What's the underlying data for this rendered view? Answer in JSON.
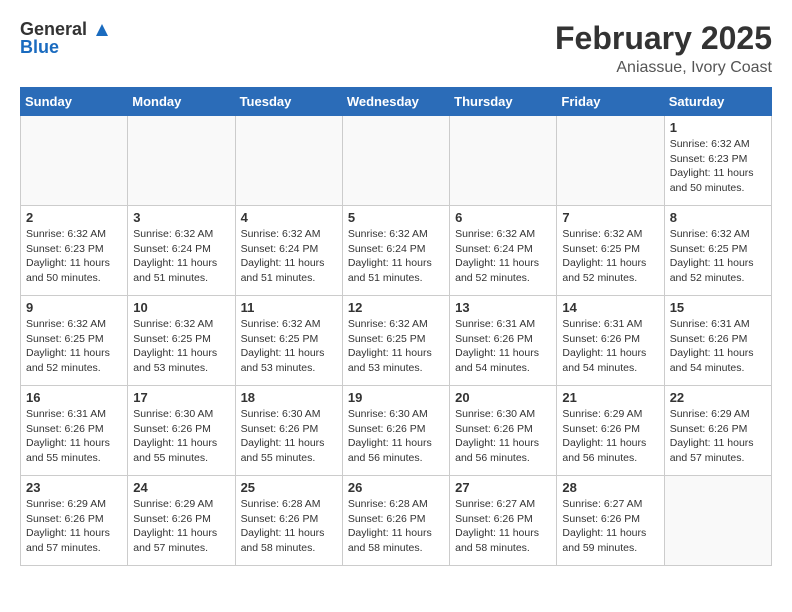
{
  "header": {
    "logo_general": "General",
    "logo_blue": "Blue",
    "month_title": "February 2025",
    "location": "Aniassue, Ivory Coast"
  },
  "weekdays": [
    "Sunday",
    "Monday",
    "Tuesday",
    "Wednesday",
    "Thursday",
    "Friday",
    "Saturday"
  ],
  "weeks": [
    [
      {
        "day": "",
        "info": ""
      },
      {
        "day": "",
        "info": ""
      },
      {
        "day": "",
        "info": ""
      },
      {
        "day": "",
        "info": ""
      },
      {
        "day": "",
        "info": ""
      },
      {
        "day": "",
        "info": ""
      },
      {
        "day": "1",
        "info": "Sunrise: 6:32 AM\nSunset: 6:23 PM\nDaylight: 11 hours\nand 50 minutes."
      }
    ],
    [
      {
        "day": "2",
        "info": "Sunrise: 6:32 AM\nSunset: 6:23 PM\nDaylight: 11 hours\nand 50 minutes."
      },
      {
        "day": "3",
        "info": "Sunrise: 6:32 AM\nSunset: 6:24 PM\nDaylight: 11 hours\nand 51 minutes."
      },
      {
        "day": "4",
        "info": "Sunrise: 6:32 AM\nSunset: 6:24 PM\nDaylight: 11 hours\nand 51 minutes."
      },
      {
        "day": "5",
        "info": "Sunrise: 6:32 AM\nSunset: 6:24 PM\nDaylight: 11 hours\nand 51 minutes."
      },
      {
        "day": "6",
        "info": "Sunrise: 6:32 AM\nSunset: 6:24 PM\nDaylight: 11 hours\nand 52 minutes."
      },
      {
        "day": "7",
        "info": "Sunrise: 6:32 AM\nSunset: 6:25 PM\nDaylight: 11 hours\nand 52 minutes."
      },
      {
        "day": "8",
        "info": "Sunrise: 6:32 AM\nSunset: 6:25 PM\nDaylight: 11 hours\nand 52 minutes."
      }
    ],
    [
      {
        "day": "9",
        "info": "Sunrise: 6:32 AM\nSunset: 6:25 PM\nDaylight: 11 hours\nand 52 minutes."
      },
      {
        "day": "10",
        "info": "Sunrise: 6:32 AM\nSunset: 6:25 PM\nDaylight: 11 hours\nand 53 minutes."
      },
      {
        "day": "11",
        "info": "Sunrise: 6:32 AM\nSunset: 6:25 PM\nDaylight: 11 hours\nand 53 minutes."
      },
      {
        "day": "12",
        "info": "Sunrise: 6:32 AM\nSunset: 6:25 PM\nDaylight: 11 hours\nand 53 minutes."
      },
      {
        "day": "13",
        "info": "Sunrise: 6:31 AM\nSunset: 6:26 PM\nDaylight: 11 hours\nand 54 minutes."
      },
      {
        "day": "14",
        "info": "Sunrise: 6:31 AM\nSunset: 6:26 PM\nDaylight: 11 hours\nand 54 minutes."
      },
      {
        "day": "15",
        "info": "Sunrise: 6:31 AM\nSunset: 6:26 PM\nDaylight: 11 hours\nand 54 minutes."
      }
    ],
    [
      {
        "day": "16",
        "info": "Sunrise: 6:31 AM\nSunset: 6:26 PM\nDaylight: 11 hours\nand 55 minutes."
      },
      {
        "day": "17",
        "info": "Sunrise: 6:30 AM\nSunset: 6:26 PM\nDaylight: 11 hours\nand 55 minutes."
      },
      {
        "day": "18",
        "info": "Sunrise: 6:30 AM\nSunset: 6:26 PM\nDaylight: 11 hours\nand 55 minutes."
      },
      {
        "day": "19",
        "info": "Sunrise: 6:30 AM\nSunset: 6:26 PM\nDaylight: 11 hours\nand 56 minutes."
      },
      {
        "day": "20",
        "info": "Sunrise: 6:30 AM\nSunset: 6:26 PM\nDaylight: 11 hours\nand 56 minutes."
      },
      {
        "day": "21",
        "info": "Sunrise: 6:29 AM\nSunset: 6:26 PM\nDaylight: 11 hours\nand 56 minutes."
      },
      {
        "day": "22",
        "info": "Sunrise: 6:29 AM\nSunset: 6:26 PM\nDaylight: 11 hours\nand 57 minutes."
      }
    ],
    [
      {
        "day": "23",
        "info": "Sunrise: 6:29 AM\nSunset: 6:26 PM\nDaylight: 11 hours\nand 57 minutes."
      },
      {
        "day": "24",
        "info": "Sunrise: 6:29 AM\nSunset: 6:26 PM\nDaylight: 11 hours\nand 57 minutes."
      },
      {
        "day": "25",
        "info": "Sunrise: 6:28 AM\nSunset: 6:26 PM\nDaylight: 11 hours\nand 58 minutes."
      },
      {
        "day": "26",
        "info": "Sunrise: 6:28 AM\nSunset: 6:26 PM\nDaylight: 11 hours\nand 58 minutes."
      },
      {
        "day": "27",
        "info": "Sunrise: 6:27 AM\nSunset: 6:26 PM\nDaylight: 11 hours\nand 58 minutes."
      },
      {
        "day": "28",
        "info": "Sunrise: 6:27 AM\nSunset: 6:26 PM\nDaylight: 11 hours\nand 59 minutes."
      },
      {
        "day": "",
        "info": ""
      }
    ]
  ]
}
